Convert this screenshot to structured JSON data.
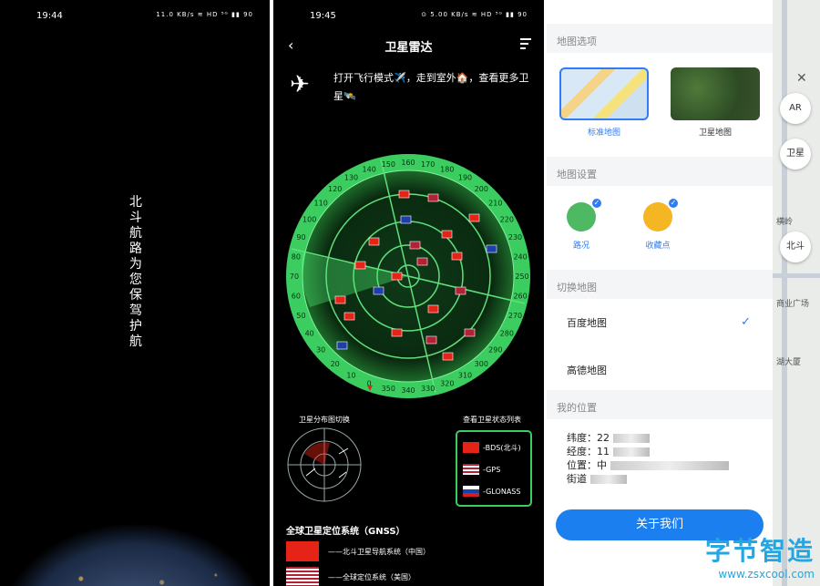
{
  "panel1": {
    "time": "19:44",
    "status": "11.0 KB/s  ≋ HD ⁵ᴳ ▮▮ 90",
    "slogan": "北斗航路 为您保驾护航"
  },
  "panel2": {
    "time": "19:45",
    "status": "⊙ 5.00 KB/s ≋ HD ⁵ᴳ ▮▮ 90",
    "title": "卫星雷达",
    "tip": "打开飞行模式✈️，走到室外🏠，查看更多卫星🛰️",
    "radar_labels": [
      "150",
      "160",
      "170",
      "180",
      "190",
      "200",
      "210",
      "220",
      "230",
      "240",
      "250",
      "260",
      "270",
      "280",
      "290",
      "300",
      "310",
      "320",
      "330",
      "340",
      "350",
      "0",
      "10",
      "20",
      "30",
      "40",
      "50",
      "60",
      "70",
      "80",
      "90",
      "100",
      "110",
      "120",
      "130",
      "140"
    ],
    "switch_label": "卫星分布图切换",
    "list_label": "查看卫星状态列表",
    "legend": [
      {
        "flag": "cn",
        "label": "-BDS(北斗)"
      },
      {
        "flag": "us",
        "label": "-GPS"
      },
      {
        "flag": "ru",
        "label": "-GLONASS"
      }
    ],
    "gnss_title": "全球卫星定位系统（GNSS）",
    "gnss": [
      {
        "flag": "cn",
        "label": "——北斗卫星导航系统（中国）"
      },
      {
        "flag": "us",
        "label": "——全球定位系统（美国）"
      }
    ]
  },
  "panel3": {
    "map_options_header": "地图选项",
    "standard_map": "标准地图",
    "satellite_map": "卫星地图",
    "map_settings_header": "地图设置",
    "traffic": "路况",
    "favorites": "收藏点",
    "switch_header": "切换地图",
    "baidu": "百度地图",
    "gaode": "高德地图",
    "location_header": "我的位置",
    "lat": "纬度：22",
    "lng": "经度：11",
    "pos": "位置：中",
    "street": "街道",
    "about": "关于我们",
    "overlay_texts": [
      "AR",
      "卫星",
      "横岭",
      "北斗",
      "商业广场",
      "湖大厦"
    ]
  },
  "watermark": {
    "line1": "字节智造",
    "line2": "www.zsxcool.com"
  }
}
